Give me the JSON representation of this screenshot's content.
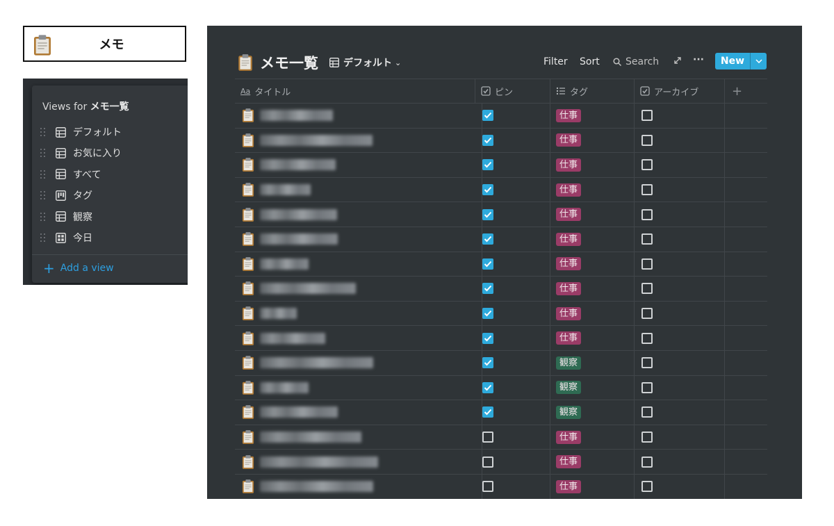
{
  "title_card": {
    "label": "メモ"
  },
  "views": {
    "title_prefix": "Views for ",
    "title_name": "メモ一覧",
    "items": [
      {
        "label": "デフォルト",
        "icon": "table-icon"
      },
      {
        "label": "お気に入り",
        "icon": "table-icon"
      },
      {
        "label": "すべて",
        "icon": "table-icon"
      },
      {
        "label": "タグ",
        "icon": "board-icon"
      },
      {
        "label": "観察",
        "icon": "table-icon"
      },
      {
        "label": "今日",
        "icon": "calendar-icon"
      }
    ],
    "add_view": "Add a view"
  },
  "db": {
    "title": "メモ一覧",
    "current_view": "デフォルト",
    "toolbar": {
      "filter": "Filter",
      "sort": "Sort",
      "search": "Search",
      "new": "New"
    },
    "columns": {
      "title": "タイトル",
      "pin": "ピン",
      "tag": "タグ",
      "archive": "アーカイブ"
    },
    "rows": [
      {
        "pin": true,
        "tag": "仕事",
        "archived": false,
        "blur": 0.62
      },
      {
        "pin": true,
        "tag": "仕事",
        "archived": false,
        "blur": 0.95
      },
      {
        "pin": true,
        "tag": "仕事",
        "archived": false,
        "blur": 0.64
      },
      {
        "pin": true,
        "tag": "仕事",
        "archived": false,
        "blur": 0.43
      },
      {
        "pin": true,
        "tag": "仕事",
        "archived": false,
        "blur": 0.65
      },
      {
        "pin": true,
        "tag": "仕事",
        "archived": false,
        "blur": 0.66
      },
      {
        "pin": true,
        "tag": "仕事",
        "archived": false,
        "blur": 0.41
      },
      {
        "pin": true,
        "tag": "仕事",
        "archived": false,
        "blur": 0.81
      },
      {
        "pin": true,
        "tag": "仕事",
        "archived": false,
        "blur": 0.31
      },
      {
        "pin": true,
        "tag": "仕事",
        "archived": false,
        "blur": 0.55
      },
      {
        "pin": true,
        "tag": "観察",
        "archived": false,
        "blur": 0.96
      },
      {
        "pin": true,
        "tag": "観察",
        "archived": false,
        "blur": 0.41
      },
      {
        "pin": true,
        "tag": "観察",
        "archived": false,
        "blur": 0.66
      },
      {
        "pin": false,
        "tag": "仕事",
        "archived": false,
        "blur": 0.86
      },
      {
        "pin": false,
        "tag": "仕事",
        "archived": false,
        "blur": 1.0
      },
      {
        "pin": false,
        "tag": "仕事",
        "archived": false,
        "blur": 0.96
      }
    ]
  },
  "colors": {
    "accent": "#2eaadc",
    "tag_work": "#9a3c67",
    "tag_observe": "#2f6b53",
    "panel_bg": "#2f3437"
  }
}
